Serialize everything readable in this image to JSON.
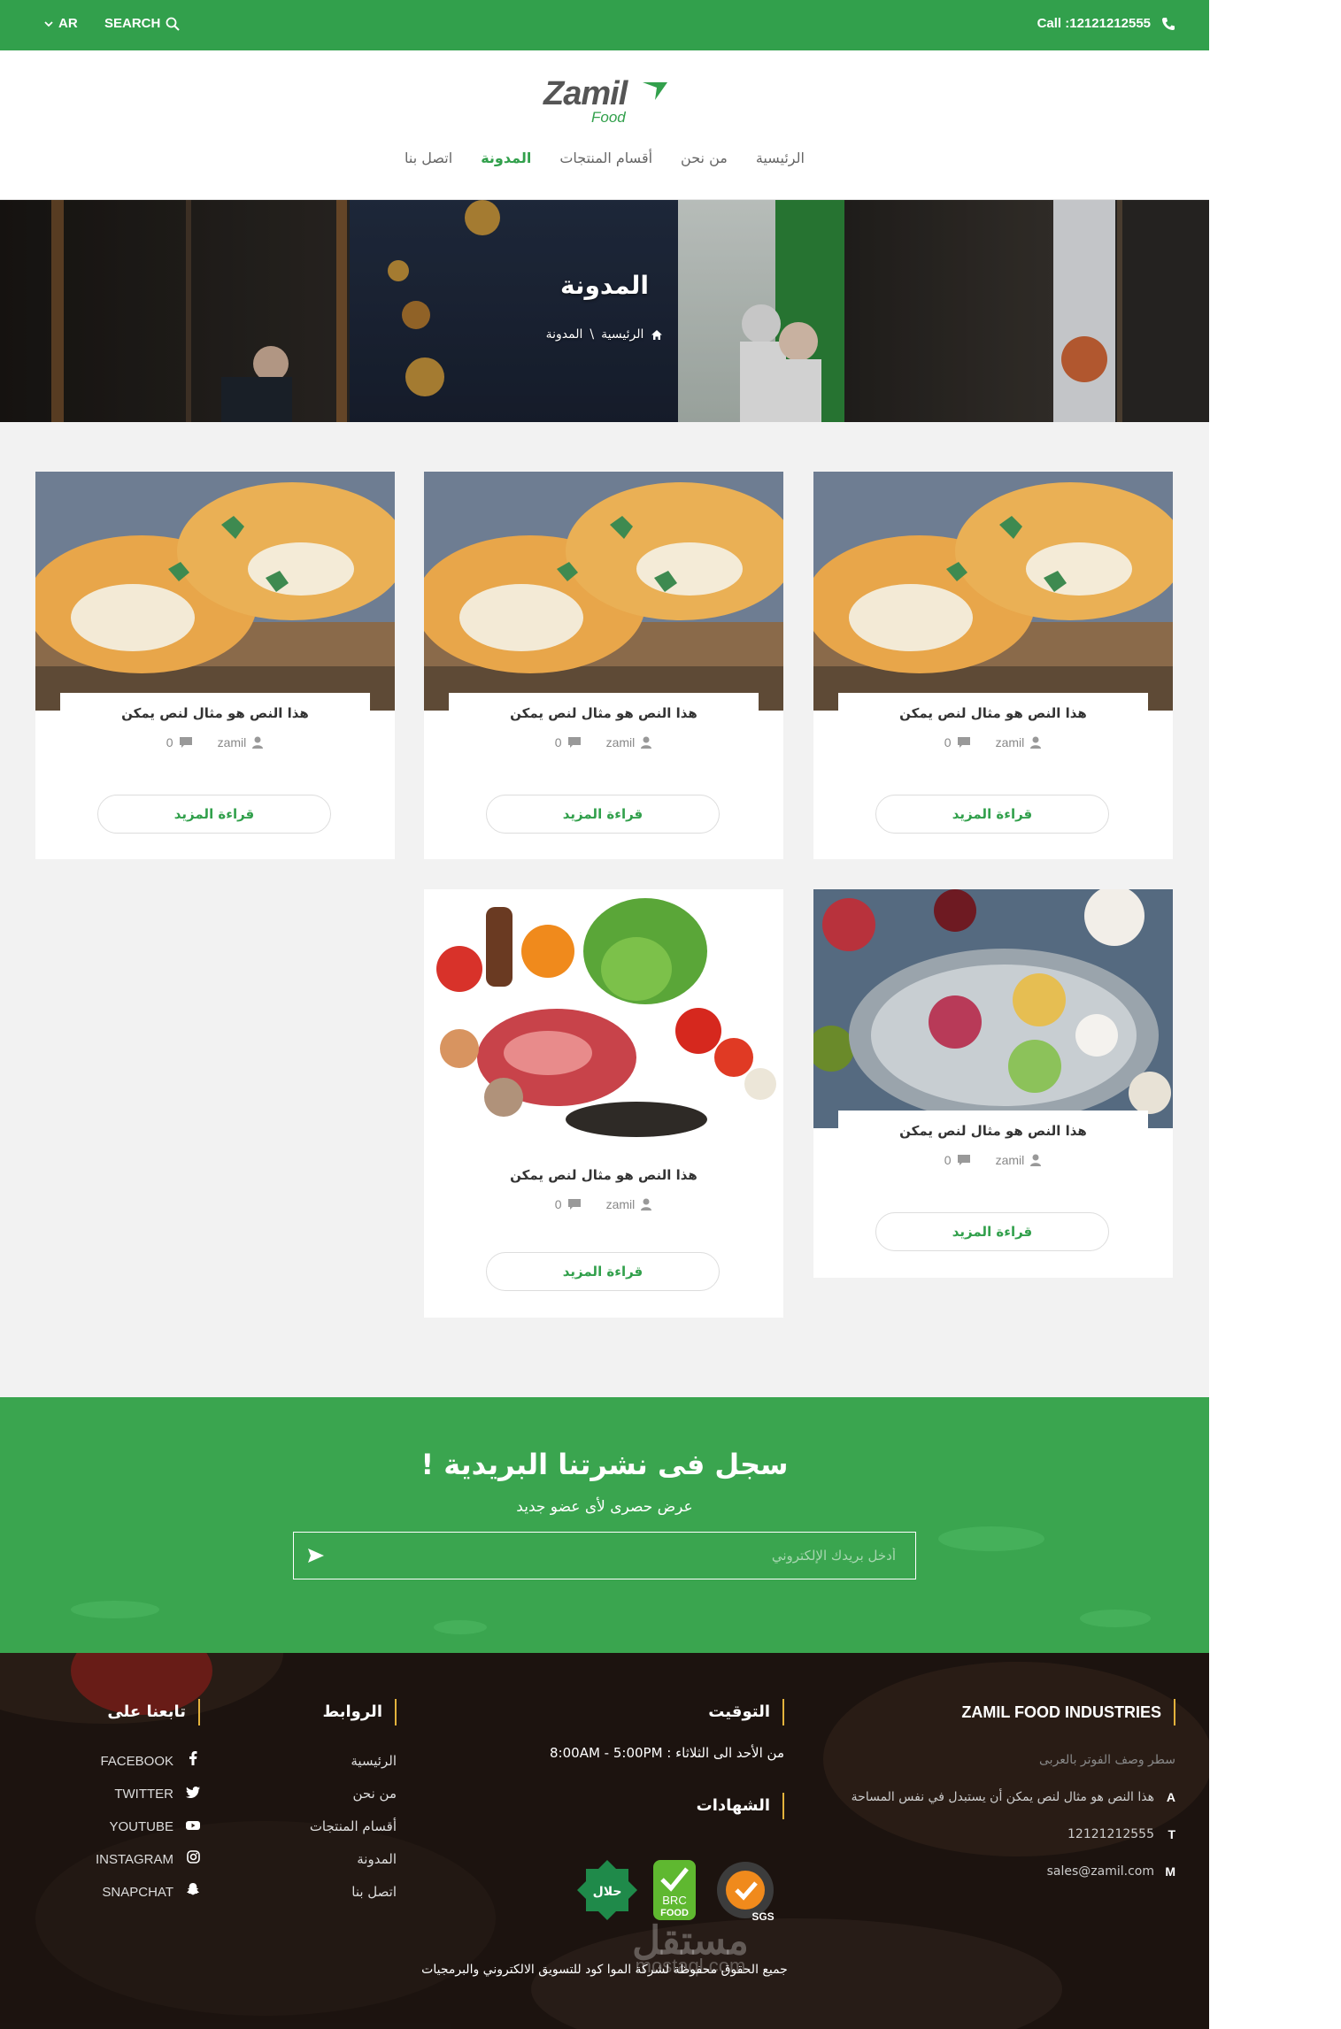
{
  "topbar": {
    "lang": "AR",
    "search": "SEARCH",
    "call": "Call :12121212555"
  },
  "brand": {
    "name": "Zamil",
    "sub": "Food"
  },
  "nav": [
    "الرئيسية",
    "من نحن",
    "أقسام المنتجات",
    "المدونة",
    "اتصل بنا"
  ],
  "hero": {
    "title": "المدونة",
    "breadcrumb": [
      "الرئيسية",
      "\\",
      "المدونة"
    ]
  },
  "posts": [
    {
      "title": "هذا النص هو مثال لنص يمكن",
      "author": "zamil",
      "comments": "0",
      "button": "قراءة المزيد",
      "image": "chicken-cutlets"
    },
    {
      "title": "هذا النص هو مثال لنص يمكن",
      "author": "zamil",
      "comments": "0",
      "button": "قراءة المزيد",
      "image": "chicken-cutlets"
    },
    {
      "title": "هذا النص هو مثال لنص يمكن",
      "author": "zamil",
      "comments": "0",
      "button": "قراءة المزيد",
      "image": "chicken-cutlets"
    },
    {
      "title": "هذا النص هو مثال لنص يمكن",
      "author": "zamil",
      "comments": "0",
      "button": "قراءة المزيد",
      "image": "ice-cream"
    },
    {
      "title": "هذا النص هو مثال لنص يمكن",
      "author": "zamil",
      "comments": "0",
      "button": "قراءة المزيد",
      "image": "meat-vegetables"
    }
  ],
  "newsletter": {
    "title": "سجل فى نشرتنا البريدية !",
    "subtitle": "عرض حصرى لأى عضو جديد",
    "placeholder": "أدخل بريدك الإلكتروني"
  },
  "footer": {
    "company": {
      "heading": "ZAMIL FOOD INDUSTRIES",
      "tagline": "سطر وصف الفوتر بالعربى",
      "address_key": "A",
      "address": "هذا النص هو مثال لنص يمكن أن يستبدل في نفس المساحة",
      "phone_key": "T",
      "phone": "12121212555",
      "email_key": "M",
      "email": "sales@zamil.com"
    },
    "timing": {
      "heading": "التوقيت",
      "hours": "من الأحد الى الثلاثاء : 8:00AM - 5:00PM"
    },
    "certificates": {
      "heading": "الشهادات",
      "items": [
        "halal",
        "brc-food",
        "sgs"
      ],
      "halal_text": "حلال",
      "brc_text": "BRC",
      "brc_food": "FOOD",
      "sgs_text": "SGS"
    },
    "links": {
      "heading": "الروابط",
      "items": [
        "الرئيسية",
        "من نحن",
        "أقسام المنتجات",
        "المدونة",
        "اتصل بنا"
      ]
    },
    "follow": {
      "heading": "تابعنا على",
      "items": [
        "FACEBOOK",
        "TWITTER",
        "YOUTUBE",
        "INSTAGRAM",
        "SNAPCHAT"
      ]
    },
    "copyright": "جميع الحقوق محفوظة لشركة الموا كود للتسويق الالكتروني والبرمجيات",
    "watermark_ar": "مستقل",
    "watermark_lat": "mostaql.com"
  },
  "colors": {
    "brand_green": "#32a04c",
    "newsletter_green": "#3aa54f",
    "accent_gold": "#e3b23c"
  }
}
